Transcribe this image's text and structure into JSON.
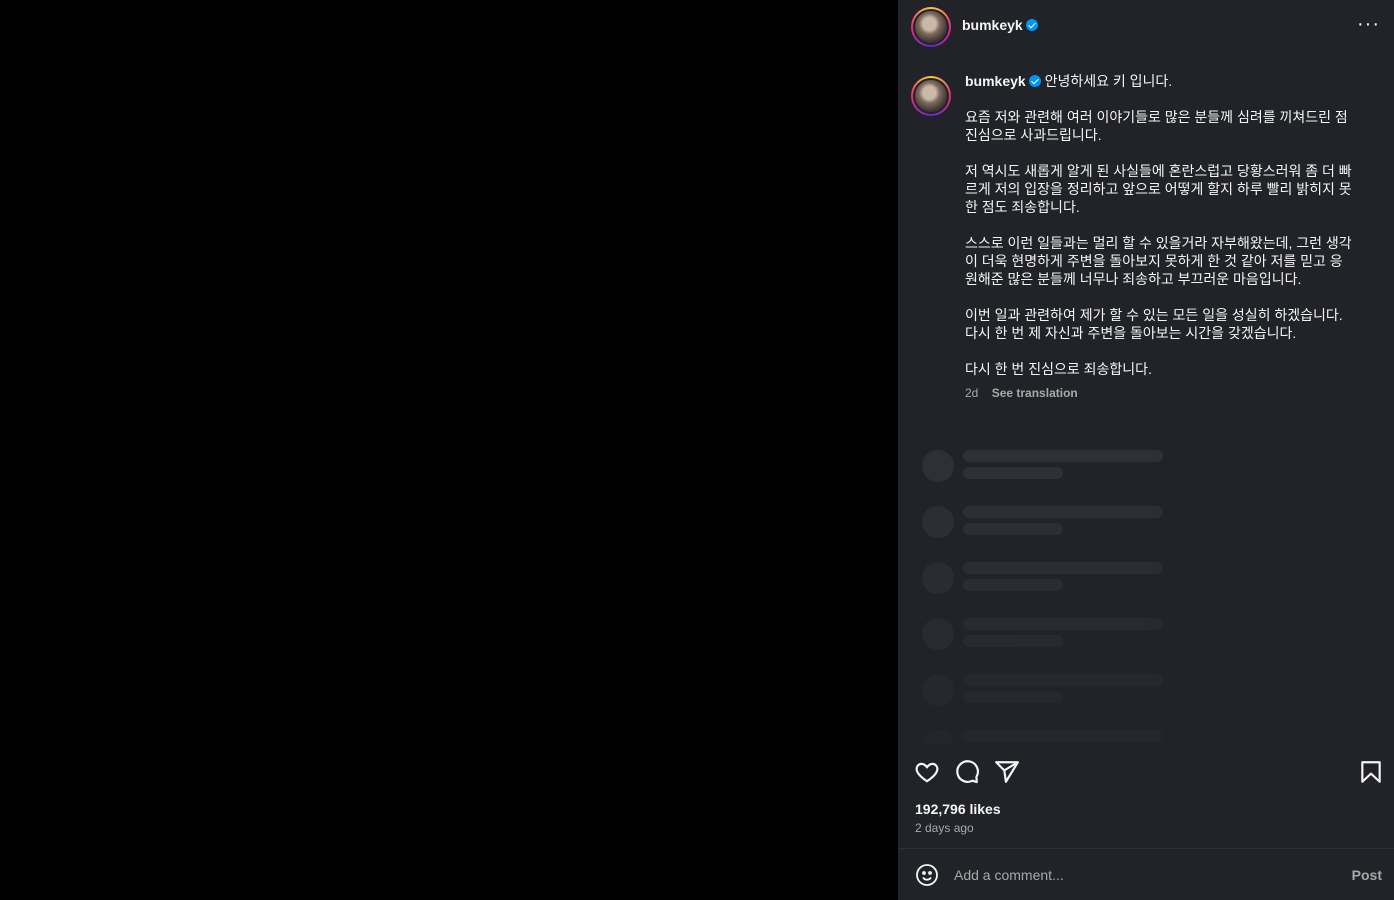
{
  "post": {
    "username": "bumkeyk",
    "caption_first_line": "안녕하세요 키 입니다.",
    "caption_paragraphs": [
      [
        "요즘 저와 관련해 여러 이야기들로 많은 분들께 심려를 끼쳐드린 점",
        "진심으로 사과드립니다."
      ],
      [
        "저 역시도 새롭게 알게 된 사실들에 혼란스럽고 당황스러워 좀 더 빠",
        "르게 저의 입장을 정리하고 앞으로 어떻게 할지 하루 빨리 밝히지 못",
        "한 점도 죄송합니다."
      ],
      [
        "스스로 이런 일들과는 멀리 할 수 있을거라 자부해왔는데, 그런 생각",
        "이 더욱 현명하게 주변을 돌아보지 못하게 한 것 같아 저를 믿고 응",
        "원해준 많은 분들께 너무나 죄송하고 부끄러운 마음입니다."
      ],
      [
        "이번 일과 관련하여 제가 할 수 있는 모든 일을 성실히 하겠습니다.",
        "다시 한 번 제 자신과 주변을 돌아보는 시간을 갖겠습니다."
      ],
      [
        "다시 한 번 진심으로 죄송합니다."
      ]
    ],
    "time_short": "2d",
    "see_translation": "See translation",
    "likes": "192,796 likes",
    "time_long": "2 days ago"
  },
  "header": {
    "more": "···"
  },
  "comment": {
    "placeholder": "Add a comment...",
    "post_label": "Post"
  },
  "icons": {
    "more": "more-options-icon",
    "like": "heart-icon",
    "comment": "comment-icon",
    "share": "share-icon",
    "save": "bookmark-icon",
    "emoji": "emoji-icon"
  },
  "colors": {
    "verified": "#0095f6",
    "panel": "#212328",
    "muted": "#a8a8a8"
  }
}
